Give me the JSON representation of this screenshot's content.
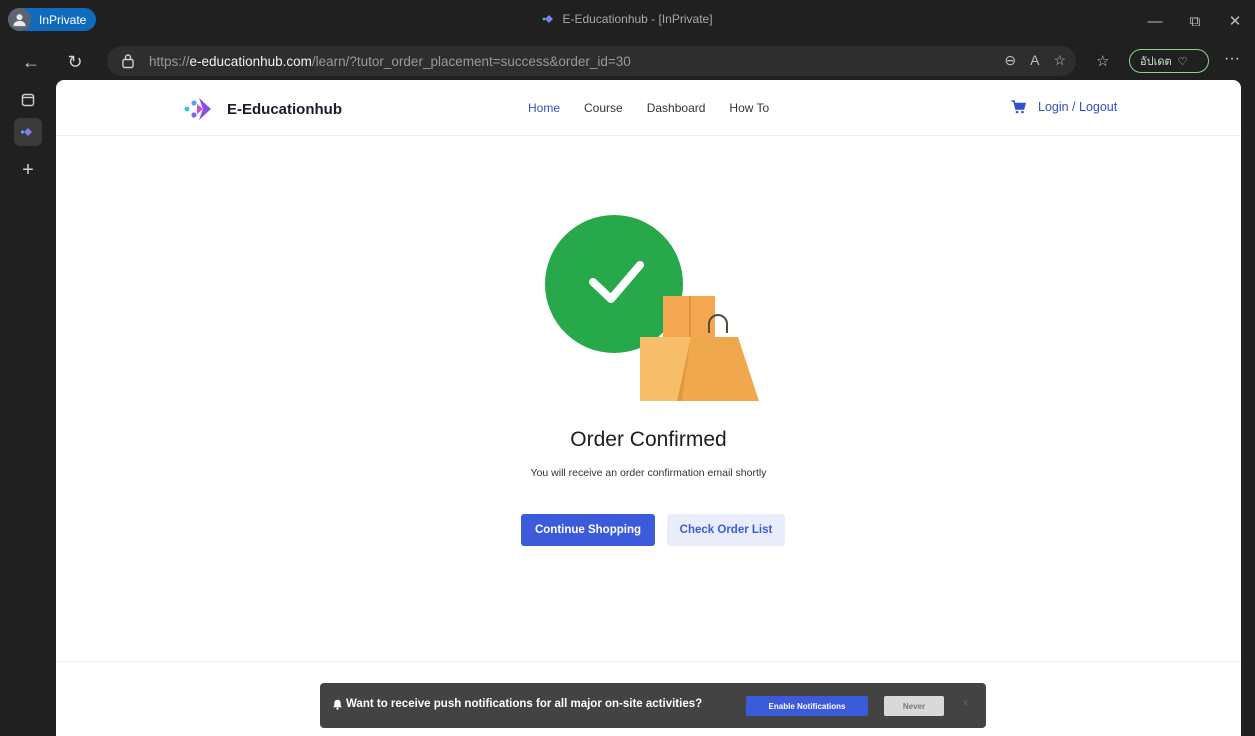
{
  "browser": {
    "profile_label": "InPrivate",
    "window_title": "E-Educationhub - [InPrivate]",
    "url_prefix": "https://",
    "url_domain": "e-educationhub.com",
    "url_path": "/learn/?tutor_order_placement=success&order_id=30",
    "update_label": "อัปเดต",
    "more_label": "···"
  },
  "site": {
    "brand": "E-Educationhub",
    "nav": [
      "Home",
      "Course",
      "Dashboard",
      "How To"
    ],
    "login_label": "Login / Logout"
  },
  "order": {
    "title": "Order Confirmed",
    "subtitle": "You will receive an order confirmation email shortly",
    "continue_label": "Continue Shopping",
    "check_label": "Check Order List"
  },
  "notification": {
    "message": "Want to receive push notifications for all major on-site activities?",
    "enable_label": "Enable Notifications",
    "never_label": "Never",
    "close_label": "×"
  },
  "colors": {
    "accent": "#3b5bdb",
    "success": "#27a84a",
    "bag": "#f0b155"
  }
}
